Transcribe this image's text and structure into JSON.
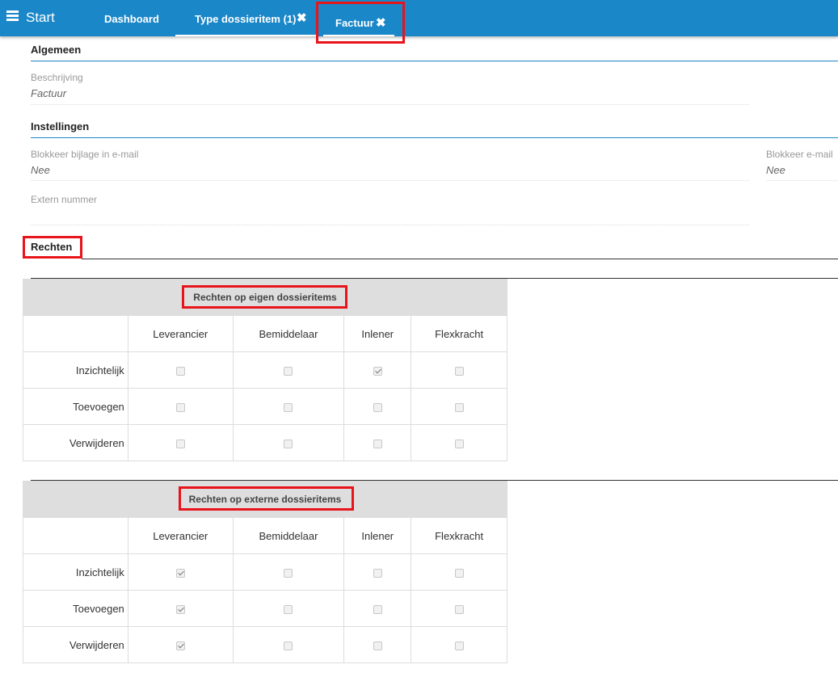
{
  "header": {
    "start_label": "Start",
    "tabs": [
      {
        "label": "Dashboard",
        "closable": false,
        "active": false
      },
      {
        "label": "Type dossieritem (1)",
        "closable": true,
        "active": false
      },
      {
        "label": "Factuur",
        "closable": true,
        "active": true
      }
    ],
    "close_glyph": "✖",
    "icons": {
      "menu": "hamburger-menu-icon",
      "close": "close-icon"
    },
    "colors": {
      "bar": "#1a87c9",
      "highlight": "#e8141b"
    }
  },
  "algemeen": {
    "title": "Algemeen",
    "beschrijving_label": "Beschrijving",
    "beschrijving_value": "Factuur"
  },
  "instellingen": {
    "title": "Instellingen",
    "blokkeer_bijlage_label": "Blokkeer bijlage in e-mail",
    "blokkeer_bijlage_value": "Nee",
    "blokkeer_email_label": "Blokkeer e-mail",
    "blokkeer_email_value": "Nee",
    "extern_nummer_label": "Extern nummer",
    "extern_nummer_value": ""
  },
  "rechten": {
    "title": "Rechten",
    "columns": [
      "Leverancier",
      "Bemiddelaar",
      "Inlener",
      "Flexkracht"
    ],
    "rows": [
      "Inzichtelijk",
      "Toevoegen",
      "Verwijderen"
    ],
    "eigen": {
      "title": "Rechten op eigen dossieritems",
      "checked": [
        [
          false,
          false,
          true,
          false
        ],
        [
          false,
          false,
          false,
          false
        ],
        [
          false,
          false,
          false,
          false
        ]
      ]
    },
    "extern": {
      "title": "Rechten op externe dossieritems",
      "checked": [
        [
          true,
          false,
          false,
          false
        ],
        [
          true,
          false,
          false,
          false
        ],
        [
          true,
          false,
          false,
          false
        ]
      ]
    }
  }
}
